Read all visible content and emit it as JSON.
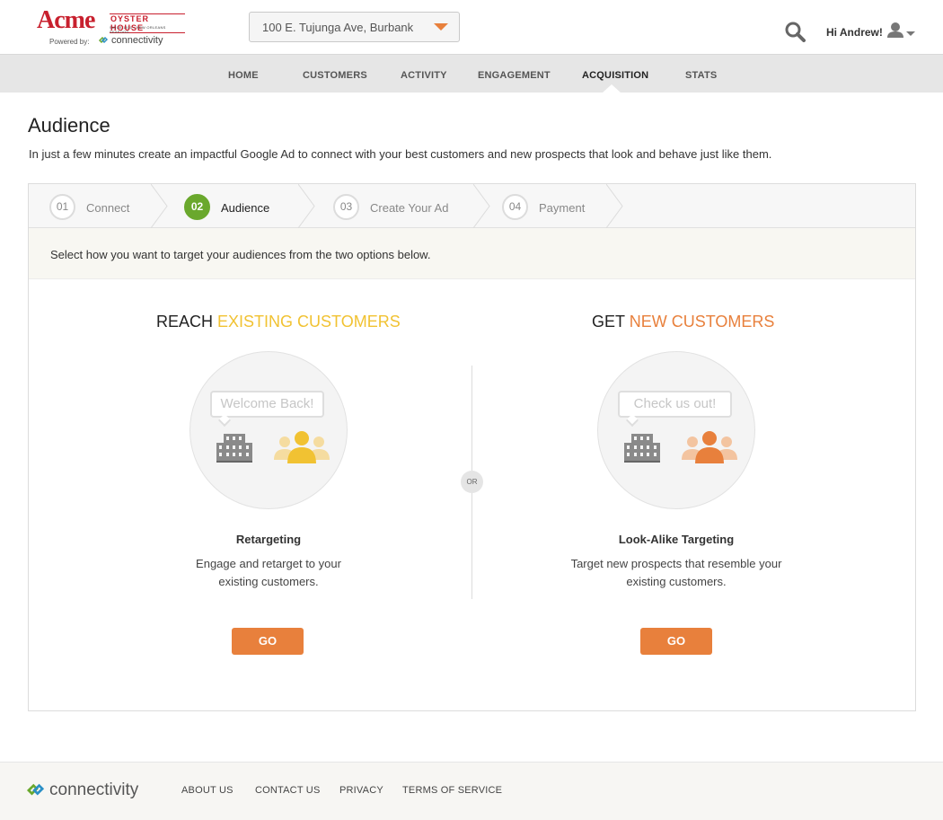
{
  "brand": {
    "name": "Acme",
    "tagline": "OYSTER HOUSE",
    "since": "SINCE 1910 • NEW ORLEANS SEAFOOD",
    "powered_by": "Powered by:",
    "partner": "connectivity"
  },
  "header": {
    "location": "100 E. Tujunga Ave, Burbank",
    "greeting": "Hi Andrew!"
  },
  "nav": {
    "items": [
      {
        "label": "HOME"
      },
      {
        "label": "CUSTOMERS"
      },
      {
        "label": "ACTIVITY"
      },
      {
        "label": "ENGAGEMENT"
      },
      {
        "label": "ACQUISITION"
      },
      {
        "label": "STATS"
      }
    ],
    "active": "ACQUISITION"
  },
  "page": {
    "title": "Audience",
    "description": "In just a few minutes create an impactful Google Ad to connect with your best customers and new prospects that look and behave just like them."
  },
  "wizard": {
    "steps": [
      {
        "num": "01",
        "label": "Connect"
      },
      {
        "num": "02",
        "label": "Audience"
      },
      {
        "num": "03",
        "label": "Create Your Ad"
      },
      {
        "num": "04",
        "label": "Payment"
      }
    ],
    "active_step": "02",
    "instruction": "Select how you want to target your audiences from the two options below.",
    "or_label": "OR"
  },
  "options": {
    "existing": {
      "title_prefix": "REACH",
      "title_accent": "EXISTING CUSTOMERS",
      "bubble": "Welcome Back!",
      "name": "Retargeting",
      "desc_line1": "Engage and retarget to your",
      "desc_line2": "existing customers.",
      "button": "GO",
      "accent_color": "#f1c232"
    },
    "new": {
      "title_prefix": "GET",
      "title_accent": "NEW CUSTOMERS",
      "bubble": "Check us out!",
      "name": "Look-Alike Targeting",
      "desc_line1": "Target new prospects that resemble your",
      "desc_line2": "existing customers.",
      "button": "GO",
      "accent_color": "#e8803c"
    }
  },
  "footer": {
    "brand": "connectivity",
    "links": [
      {
        "label": "ABOUT US"
      },
      {
        "label": "CONTACT US"
      },
      {
        "label": "PRIVACY"
      },
      {
        "label": "TERMS OF SERVICE"
      }
    ]
  },
  "icons": {
    "search": "search-icon",
    "user": "user-icon",
    "caret": "chevron-down-icon",
    "building": "building-icon",
    "people": "people-group-icon",
    "connectivity": "connectivity-logo-icon"
  },
  "colors": {
    "brand_red": "#c8202e",
    "step_active": "#6aa82d",
    "button": "#e8803c",
    "yellow_accent": "#f1c232",
    "orange_accent": "#e8803c"
  }
}
